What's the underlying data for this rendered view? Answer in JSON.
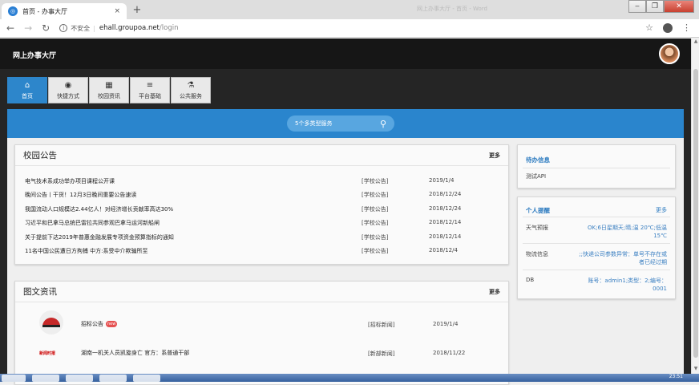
{
  "browser": {
    "tab_title": "首页 - 办事大厅",
    "tab_close": "×",
    "new_tab": "+",
    "window_title": "网上办事大厅 - 首页 - Word",
    "window_buttons": [
      "‒",
      "❐",
      "✕"
    ],
    "insecure_label": "不安全",
    "url_host": "ehall.groupoa.net",
    "url_path": "/login",
    "nav_icons": [
      "arrow-left-icon",
      "arrow-right-icon",
      "reload-icon"
    ]
  },
  "header": {
    "site_title": "网上办事大厅"
  },
  "nav": {
    "tabs": [
      {
        "label": "首页",
        "icon": "⌂"
      },
      {
        "label": "快捷方式",
        "icon": "◉"
      },
      {
        "label": "校园资讯",
        "icon": "▦"
      },
      {
        "label": "平台基础",
        "icon": "≡"
      },
      {
        "label": "公共服务",
        "icon": "⚗"
      }
    ]
  },
  "search": {
    "placeholder": "5个多类型服务"
  },
  "announcements": {
    "title": "校园公告",
    "more": "更多",
    "rows": [
      {
        "title": "电气技术系成功举办项目课程公开课",
        "category": "[学校公告]",
        "date": "2019/1/4"
      },
      {
        "title": "晚间公告丨干货！12月3日晚间重要公告速读",
        "category": "[学校公告]",
        "date": "2018/12/24"
      },
      {
        "title": "我国流动人口规模达2.44亿人！对经济增长贡献率高达30%",
        "category": "[学校公告]",
        "date": "2018/12/24"
      },
      {
        "title": "习近平和巴拿马总统巴雷拉共同参观巴拿马运河新船闸",
        "category": "[学校公告]",
        "date": "2018/12/14"
      },
      {
        "title": "关于提前下达2019年普惠金融发展专项资金预算指标的通知",
        "category": "[学校公告]",
        "date": "2018/12/14"
      },
      {
        "title": "11名中国公民遭日方拘捕 中方:系受中介欺骗所至",
        "category": "[学校公告]",
        "date": "2018/12/4"
      }
    ]
  },
  "news": {
    "title": "图文资讯",
    "more": "更多",
    "rows": [
      {
        "title": "招标公告",
        "badge": "new",
        "category": "[招标新闻]",
        "date": "2019/1/4"
      },
      {
        "title": "湖南一机关人员凯旋身亡 官方：系普通干部",
        "brand": "新闻时报",
        "category": "[新部新闻]",
        "date": "2018/11/22"
      }
    ]
  },
  "todo": {
    "title": "待办信息",
    "item": "测试API"
  },
  "reminders": {
    "title": "个人提醒",
    "more": "更多",
    "items": [
      {
        "label": "天气预报",
        "value": "OK;6日星期天;晴;温 20℃;低温15℃"
      },
      {
        "label": "物流信息",
        "value": ";;快递公司参数异常：单号不存在或者已经过期"
      },
      {
        "label": "DB",
        "value": "账号：admin1;类型：2;编号：0001"
      }
    ]
  },
  "taskbar": {
    "clock": "23:51"
  }
}
